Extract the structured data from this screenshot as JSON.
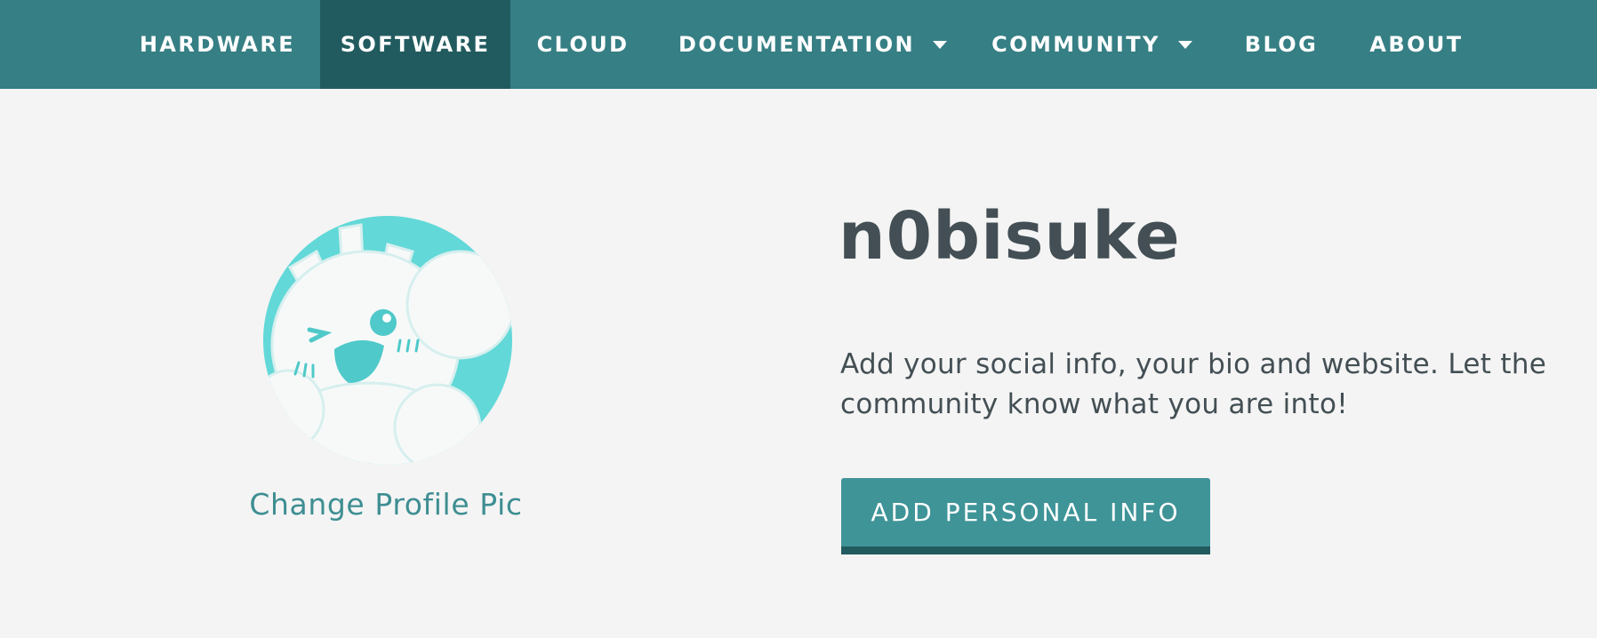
{
  "nav": {
    "items": [
      {
        "label": "HARDWARE",
        "active": false
      },
      {
        "label": "SOFTWARE",
        "active": true
      },
      {
        "label": "CLOUD",
        "active": false
      },
      {
        "label": "DOCUMENTATION",
        "active": false,
        "dropdown": true
      },
      {
        "label": "COMMUNITY",
        "active": false,
        "dropdown": true
      },
      {
        "label": "BLOG",
        "active": false
      },
      {
        "label": "ABOUT",
        "active": false
      }
    ]
  },
  "profile": {
    "avatar_icon": "cartoon-avatar-icon",
    "change_pic_label": "Change Profile Pic",
    "username": "n0bisuke",
    "bio_prompt": "Add your social info, your bio and website. Let the community know what you are into!",
    "add_info_label": "ADD PERSONAL INFO"
  },
  "colors": {
    "nav_bg": "#367f84",
    "nav_active_bg": "#225b5f",
    "page_bg": "#f4f4f4",
    "accent_text": "#3e8e92",
    "button_bg": "#3f9498",
    "button_border": "#225b5f",
    "text": "#434f54",
    "avatar_bg": "#62d8d8"
  }
}
